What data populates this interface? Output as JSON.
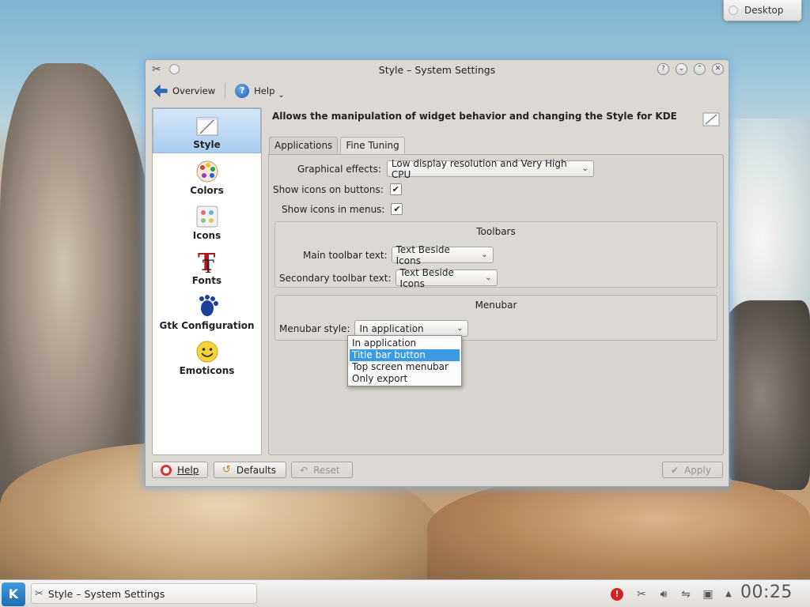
{
  "desktop": {
    "widget_label": "Desktop"
  },
  "window": {
    "title": "Style – System Settings",
    "toolbar": {
      "overview_label": "Overview",
      "help_label": "Help"
    }
  },
  "sidebar": {
    "items": [
      {
        "label": "Style",
        "icon": "style-icon"
      },
      {
        "label": "Colors",
        "icon": "colors-icon"
      },
      {
        "label": "Icons",
        "icon": "icons-icon"
      },
      {
        "label": "Fonts",
        "icon": "fonts-icon"
      },
      {
        "label": "Gtk Configuration",
        "icon": "gtk-icon"
      },
      {
        "label": "Emoticons",
        "icon": "emoticons-icon"
      }
    ]
  },
  "main": {
    "header": "Allows the manipulation of widget behavior and changing the Style for KDE",
    "tabs": [
      {
        "label": "Applications"
      },
      {
        "label": "Fine Tuning"
      }
    ],
    "fine_tuning": {
      "graphical_effects_label": "Graphical effects:",
      "graphical_effects_value": "Low display resolution and Very High CPU",
      "icons_on_buttons_label": "Show icons on buttons:",
      "icons_on_buttons_checked": true,
      "icons_in_menus_label": "Show icons in menus:",
      "icons_in_menus_checked": true,
      "toolbars": {
        "title": "Toolbars",
        "main_label": "Main toolbar text:",
        "main_value": "Text Beside Icons",
        "secondary_label": "Secondary toolbar text:",
        "secondary_value": "Text Beside Icons"
      },
      "menubar": {
        "title": "Menubar",
        "style_label": "Menubar style:",
        "style_value": "In application",
        "options": [
          "In application",
          "Title bar button",
          "Top screen menubar",
          "Only export"
        ],
        "highlighted_option": "Title bar button"
      }
    }
  },
  "buttons": {
    "help": "Help",
    "defaults": "Defaults",
    "reset": "Reset",
    "apply": "Apply"
  },
  "taskbar": {
    "task_title": "Style – System Settings",
    "clock": "00:25"
  },
  "colors": {
    "selection": "#3b9ae1",
    "accent": "#1f6db3"
  }
}
